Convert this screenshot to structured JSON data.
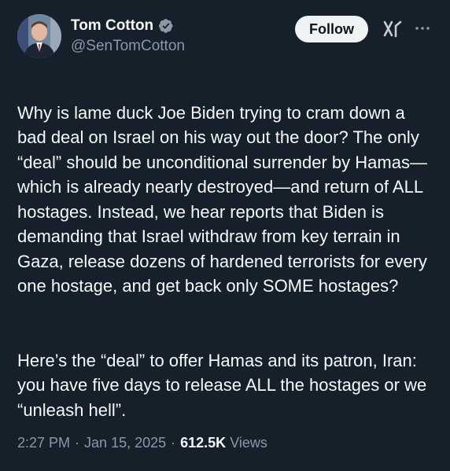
{
  "author": {
    "display_name": "Tom Cotton",
    "handle": "@SenTomCotton",
    "verified_icon": "verified-badge-icon"
  },
  "actions": {
    "follow_label": "Follow",
    "grok_icon": "grok-icon",
    "more_icon": "more-options-icon"
  },
  "tweet": {
    "paragraph_1": "Why is lame duck Joe Biden trying to cram down a bad deal on Israel on his way out the door? The only “deal” should be unconditional surrender by Hamas—which is already nearly destroyed—and return of ALL hostages. Instead, we hear reports that Biden is demanding that Israel withdraw from key terrain in Gaza, release dozens of hardened terrorists for every one hostage, and get back only SOME hostages?",
    "paragraph_2": "Here’s the “deal” to offer Hamas and its patron, Iran: you have five days to release ALL the hostages or we “unleash hell”."
  },
  "meta": {
    "time": "2:27 PM",
    "date": "Jan 15, 2025",
    "views_count": "612.5K",
    "views_label": "Views",
    "separator": "·"
  },
  "colors": {
    "background": "#15202b",
    "text_primary": "#f7f9f9",
    "text_secondary": "#8b98a5",
    "verified_blue": "#1d9bf0",
    "follow_bg": "#eff3f4"
  }
}
